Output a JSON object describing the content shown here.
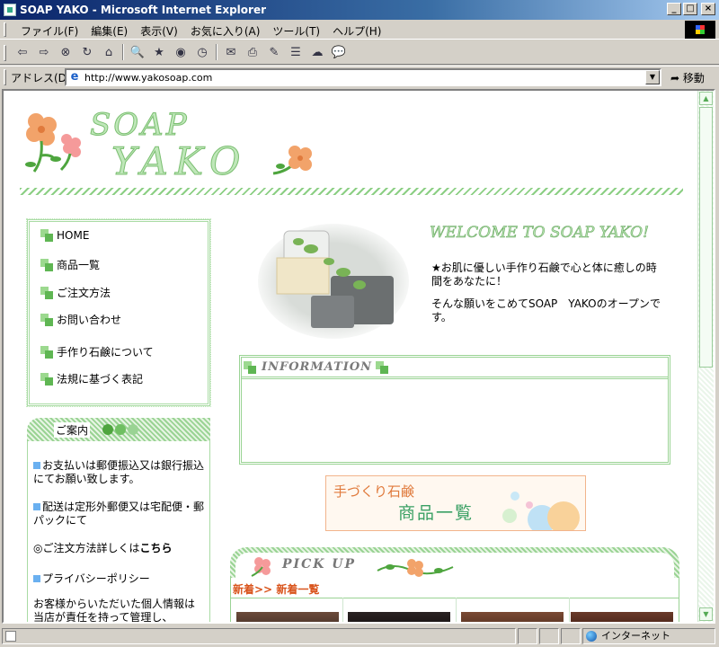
{
  "window": {
    "title": "SOAP YAKO - Microsoft Internet Explorer",
    "min": "_",
    "max": "□",
    "close": "×"
  },
  "menu": [
    "ファイル(F)",
    "編集(E)",
    "表示(V)",
    "お気に入り(A)",
    "ツール(T)",
    "ヘルプ(H)"
  ],
  "toolbar": {
    "back": "⇦",
    "forward": "⇨",
    "stop": "⊗",
    "refresh": "↻",
    "home": "⌂",
    "search": "🔍",
    "favorites": "★",
    "media": "◉",
    "history": "◷",
    "mail": "✉",
    "print": "⎙",
    "edit": "✎",
    "discuss": "☰",
    "messenger": "☁",
    "chat": "💬"
  },
  "address": {
    "label": "アドレス(D)",
    "url": "http://www.yakosoap.com",
    "go": "移動"
  },
  "page": {
    "logo_top": "SOAP",
    "logo_bottom": "YAKO",
    "nav": [
      "HOME",
      "商品一覧",
      "ご注文方法",
      "お問い合わせ",
      "手作り石鹸について",
      "法規に基づく表記"
    ],
    "guide_title": "ご案内",
    "guide": {
      "payment": "お支払いは郵便振込又は銀行振込にてお願い致します。",
      "shipping": "配送は定形外郵便又は宅配便・郵パックにて",
      "order_prefix": "◎ご注文方法詳しくは",
      "order_link": "こちら",
      "privacy": "プライバシーポリシー",
      "privacy_text": "お客様からいただいた個人情報は当店が責任を持って管理し、"
    },
    "welcome": "WELCOME TO SOAP YAKO!",
    "intro1": "★お肌に優しい手作り石鹸で心と体に癒しの時間をあなたに！",
    "intro2": "そんな願いをこめてSOAP　YAKOのオープンです。",
    "info_title": "INFORMATION",
    "banner_line1": "手づくり石鹸",
    "banner_line2": "商品一覧",
    "pickup_title": "PICK UP",
    "new_prefix": "新着>>",
    "new_link": "新着一覧"
  },
  "status": {
    "zone": "インターネット"
  },
  "colors": {
    "accent_green": "#9ad394",
    "orange": "#e07a3c",
    "flower_pink": "#f28a8a"
  }
}
